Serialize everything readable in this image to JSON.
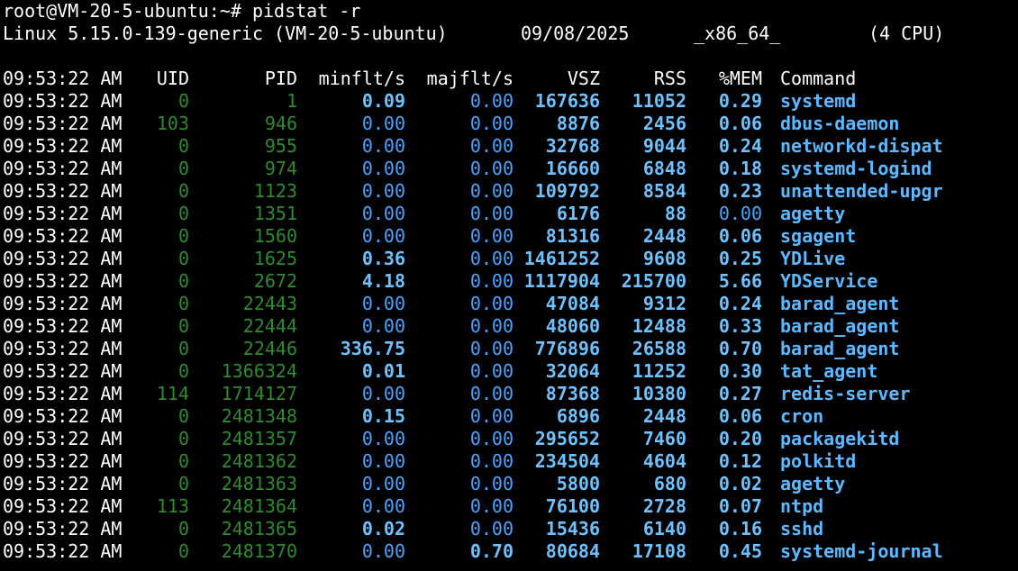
{
  "colors": {
    "background": "#000000",
    "text": "#ffffff",
    "uid": "#2e8b2e",
    "pid": "#2e8b2e",
    "value_blue": "#4aa3ff",
    "value_blue_bright": "#6ec1ff",
    "command": "#5cb8ff"
  },
  "prompt": {
    "text": "root@VM-20-5-ubuntu:~# pidstat -r"
  },
  "sysinfo": {
    "kernel": "Linux 5.15.0-139-generic (VM-20-5-ubuntu)",
    "date": "09/08/2025",
    "arch": "_x86_64_",
    "cpus": "(4 CPU)"
  },
  "table": {
    "headers": {
      "time": "09:53:22 AM",
      "uid": "UID",
      "pid": "PID",
      "minflt": "minflt/s",
      "majflt": "majflt/s",
      "vsz": "VSZ",
      "rss": "RSS",
      "mem": "%MEM",
      "cmd": "Command"
    },
    "rows": [
      {
        "time": "09:53:22 AM",
        "uid": "0",
        "pid": "1",
        "minflt": "0.09",
        "majflt": "0.00",
        "vsz": "167636",
        "rss": "11052",
        "mem": "0.29",
        "cmd": "systemd",
        "minflt_nz": true,
        "majflt_nz": false,
        "mem_nz": true
      },
      {
        "time": "09:53:22 AM",
        "uid": "103",
        "pid": "946",
        "minflt": "0.00",
        "majflt": "0.00",
        "vsz": "8876",
        "rss": "2456",
        "mem": "0.06",
        "cmd": "dbus-daemon",
        "minflt_nz": false,
        "majflt_nz": false,
        "mem_nz": true
      },
      {
        "time": "09:53:22 AM",
        "uid": "0",
        "pid": "955",
        "minflt": "0.00",
        "majflt": "0.00",
        "vsz": "32768",
        "rss": "9044",
        "mem": "0.24",
        "cmd": "networkd-dispat",
        "minflt_nz": false,
        "majflt_nz": false,
        "mem_nz": true
      },
      {
        "time": "09:53:22 AM",
        "uid": "0",
        "pid": "974",
        "minflt": "0.00",
        "majflt": "0.00",
        "vsz": "16660",
        "rss": "6848",
        "mem": "0.18",
        "cmd": "systemd-logind",
        "minflt_nz": false,
        "majflt_nz": false,
        "mem_nz": true
      },
      {
        "time": "09:53:22 AM",
        "uid": "0",
        "pid": "1123",
        "minflt": "0.00",
        "majflt": "0.00",
        "vsz": "109792",
        "rss": "8584",
        "mem": "0.23",
        "cmd": "unattended-upgr",
        "minflt_nz": false,
        "majflt_nz": false,
        "mem_nz": true
      },
      {
        "time": "09:53:22 AM",
        "uid": "0",
        "pid": "1351",
        "minflt": "0.00",
        "majflt": "0.00",
        "vsz": "6176",
        "rss": "88",
        "mem": "0.00",
        "cmd": "agetty",
        "minflt_nz": false,
        "majflt_nz": false,
        "mem_nz": false
      },
      {
        "time": "09:53:22 AM",
        "uid": "0",
        "pid": "1560",
        "minflt": "0.00",
        "majflt": "0.00",
        "vsz": "81316",
        "rss": "2448",
        "mem": "0.06",
        "cmd": "sgagent",
        "minflt_nz": false,
        "majflt_nz": false,
        "mem_nz": true
      },
      {
        "time": "09:53:22 AM",
        "uid": "0",
        "pid": "1625",
        "minflt": "0.36",
        "majflt": "0.00",
        "vsz": "1461252",
        "rss": "9608",
        "mem": "0.25",
        "cmd": "YDLive",
        "minflt_nz": true,
        "majflt_nz": false,
        "mem_nz": true
      },
      {
        "time": "09:53:22 AM",
        "uid": "0",
        "pid": "2672",
        "minflt": "4.18",
        "majflt": "0.00",
        "vsz": "1117904",
        "rss": "215700",
        "mem": "5.66",
        "cmd": "YDService",
        "minflt_nz": true,
        "majflt_nz": false,
        "mem_nz": true
      },
      {
        "time": "09:53:22 AM",
        "uid": "0",
        "pid": "22443",
        "minflt": "0.00",
        "majflt": "0.00",
        "vsz": "47084",
        "rss": "9312",
        "mem": "0.24",
        "cmd": "barad_agent",
        "minflt_nz": false,
        "majflt_nz": false,
        "mem_nz": true
      },
      {
        "time": "09:53:22 AM",
        "uid": "0",
        "pid": "22444",
        "minflt": "0.00",
        "majflt": "0.00",
        "vsz": "48060",
        "rss": "12488",
        "mem": "0.33",
        "cmd": "barad_agent",
        "minflt_nz": false,
        "majflt_nz": false,
        "mem_nz": true
      },
      {
        "time": "09:53:22 AM",
        "uid": "0",
        "pid": "22446",
        "minflt": "336.75",
        "majflt": "0.00",
        "vsz": "776896",
        "rss": "26588",
        "mem": "0.70",
        "cmd": "barad_agent",
        "minflt_nz": true,
        "majflt_nz": false,
        "mem_nz": true
      },
      {
        "time": "09:53:22 AM",
        "uid": "0",
        "pid": "1366324",
        "minflt": "0.01",
        "majflt": "0.00",
        "vsz": "32064",
        "rss": "11252",
        "mem": "0.30",
        "cmd": "tat_agent",
        "minflt_nz": true,
        "majflt_nz": false,
        "mem_nz": true
      },
      {
        "time": "09:53:22 AM",
        "uid": "114",
        "pid": "1714127",
        "minflt": "0.00",
        "majflt": "0.00",
        "vsz": "87368",
        "rss": "10380",
        "mem": "0.27",
        "cmd": "redis-server",
        "minflt_nz": false,
        "majflt_nz": false,
        "mem_nz": true
      },
      {
        "time": "09:53:22 AM",
        "uid": "0",
        "pid": "2481348",
        "minflt": "0.15",
        "majflt": "0.00",
        "vsz": "6896",
        "rss": "2448",
        "mem": "0.06",
        "cmd": "cron",
        "minflt_nz": true,
        "majflt_nz": false,
        "mem_nz": true
      },
      {
        "time": "09:53:22 AM",
        "uid": "0",
        "pid": "2481357",
        "minflt": "0.00",
        "majflt": "0.00",
        "vsz": "295652",
        "rss": "7460",
        "mem": "0.20",
        "cmd": "packagekitd",
        "minflt_nz": false,
        "majflt_nz": false,
        "mem_nz": true
      },
      {
        "time": "09:53:22 AM",
        "uid": "0",
        "pid": "2481362",
        "minflt": "0.00",
        "majflt": "0.00",
        "vsz": "234504",
        "rss": "4604",
        "mem": "0.12",
        "cmd": "polkitd",
        "minflt_nz": false,
        "majflt_nz": false,
        "mem_nz": true
      },
      {
        "time": "09:53:22 AM",
        "uid": "0",
        "pid": "2481363",
        "minflt": "0.00",
        "majflt": "0.00",
        "vsz": "5800",
        "rss": "680",
        "mem": "0.02",
        "cmd": "agetty",
        "minflt_nz": false,
        "majflt_nz": false,
        "mem_nz": true
      },
      {
        "time": "09:53:22 AM",
        "uid": "113",
        "pid": "2481364",
        "minflt": "0.00",
        "majflt": "0.00",
        "vsz": "76100",
        "rss": "2728",
        "mem": "0.07",
        "cmd": "ntpd",
        "minflt_nz": false,
        "majflt_nz": false,
        "mem_nz": true
      },
      {
        "time": "09:53:22 AM",
        "uid": "0",
        "pid": "2481365",
        "minflt": "0.02",
        "majflt": "0.00",
        "vsz": "15436",
        "rss": "6140",
        "mem": "0.16",
        "cmd": "sshd",
        "minflt_nz": true,
        "majflt_nz": false,
        "mem_nz": true
      },
      {
        "time": "09:53:22 AM",
        "uid": "0",
        "pid": "2481370",
        "minflt": "0.00",
        "majflt": "0.70",
        "vsz": "80684",
        "rss": "17108",
        "mem": "0.45",
        "cmd": "systemd-journal",
        "minflt_nz": false,
        "majflt_nz": true,
        "mem_nz": true
      }
    ]
  }
}
